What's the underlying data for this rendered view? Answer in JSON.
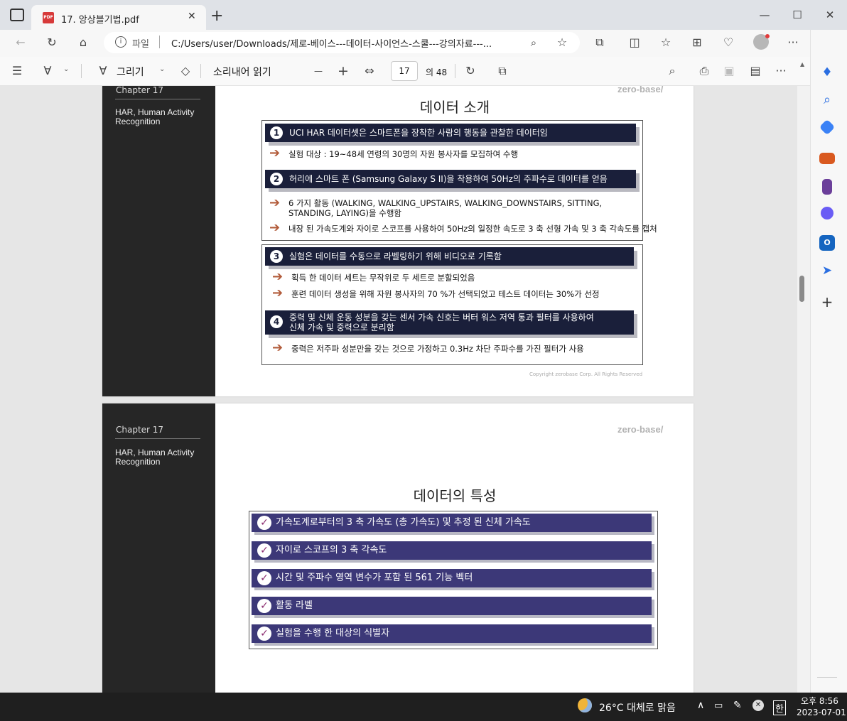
{
  "browser": {
    "tab_title": "17. 앙상블기법.pdf",
    "pdf_icon_text": "PDF",
    "address_label": "파일",
    "url": "C:/Users/user/Downloads/제로-베이스---데이터-사이언스-스쿨---강의자료---...",
    "new_tab": "+",
    "win_min": "—",
    "win_max": "☐",
    "win_close": "✕"
  },
  "pdf_toolbar": {
    "draw_label": "그리기",
    "read_aloud": "소리내어 읽기",
    "zoom_out": "—",
    "zoom_in": "+",
    "page_current": "17",
    "page_total": "의 48"
  },
  "slide1": {
    "chapter": "Chapter   17",
    "har": "HAR, Human Activity Recognition",
    "brand": "zero-base/",
    "title": "데이터 소개",
    "footer": "Copyright zerobase Corp. All Rights Reserved",
    "panel1": {
      "items": [
        {
          "num": "1",
          "text": "UCI HAR 데이터셋은 스마트폰을 장착한 사람의 행동을 관찰한 데이터임",
          "subs": [
            "실험 대상 : 19~48세 연령의 30명의 자원 봉사자를 모집하여 수행"
          ]
        },
        {
          "num": "2",
          "text": "허리에 스마트 폰 (Samsung Galaxy S II)을 착용하여 50Hz의 주파수로 데이터를 얻음",
          "subs": [
            "6 가지 활동 (WALKING, WALKING_UPSTAIRS, WALKING_DOWNSTAIRS, SITTING,",
            "STANDING, LAYING)을 수행함",
            "내장 된 가속도계와 자이로 스코프를 사용하여 50Hz의 일정한 속도로 3 축 선형 가속 및 3 축 각속도를 캡처"
          ]
        }
      ]
    },
    "panel2": {
      "items": [
        {
          "num": "3",
          "text": "실험은 데이터를 수동으로 라벨링하기 위해 비디오로 기록함",
          "subs": [
            "획득 한 데이터 세트는 무작위로 두 세트로 분할되었음",
            "훈련 데이터 생성을 위해 자원 봉사자의 70 %가 선택되었고 테스트 데이터는 30%가 선정"
          ]
        },
        {
          "num": "4",
          "text": "중력 및 신체 운동 성분을 갖는 센서 가속 신호는 버터 워스 저역 통과 필터를 사용하여",
          "text2": "신체 가속 및 중력으로 분리함",
          "subs": [
            "중력은 저주파 성분만을 갖는 것으로 가정하고 0.3Hz 차단 주파수를 가진 필터가 사용"
          ]
        }
      ]
    }
  },
  "slide2": {
    "chapter": "Chapter   17",
    "har": "HAR, Human Activity Recognition",
    "brand": "zero-base/",
    "title": "데이터의 특성",
    "items": [
      "가속도계로부터의 3 축 가속도 (총 가속도) 및 추정 된 신체 가속도",
      "자이로 스코프의 3 축 각속도",
      "시간 및 주파수 영역 변수가 포함 된 561 기능 벡터",
      "활동 라벨",
      "실험을 수행 한 대상의 식별자"
    ]
  },
  "taskbar": {
    "weather": "26°C  대체로 맑음",
    "ime": "한",
    "time": "오후 8:56",
    "date": "2023-07-01"
  },
  "colors": {
    "slide_bar": "#1a1f3a",
    "feature_bar": "#3c3878",
    "arrow": "#b25b3a",
    "sidebar_dark": "#262626"
  }
}
